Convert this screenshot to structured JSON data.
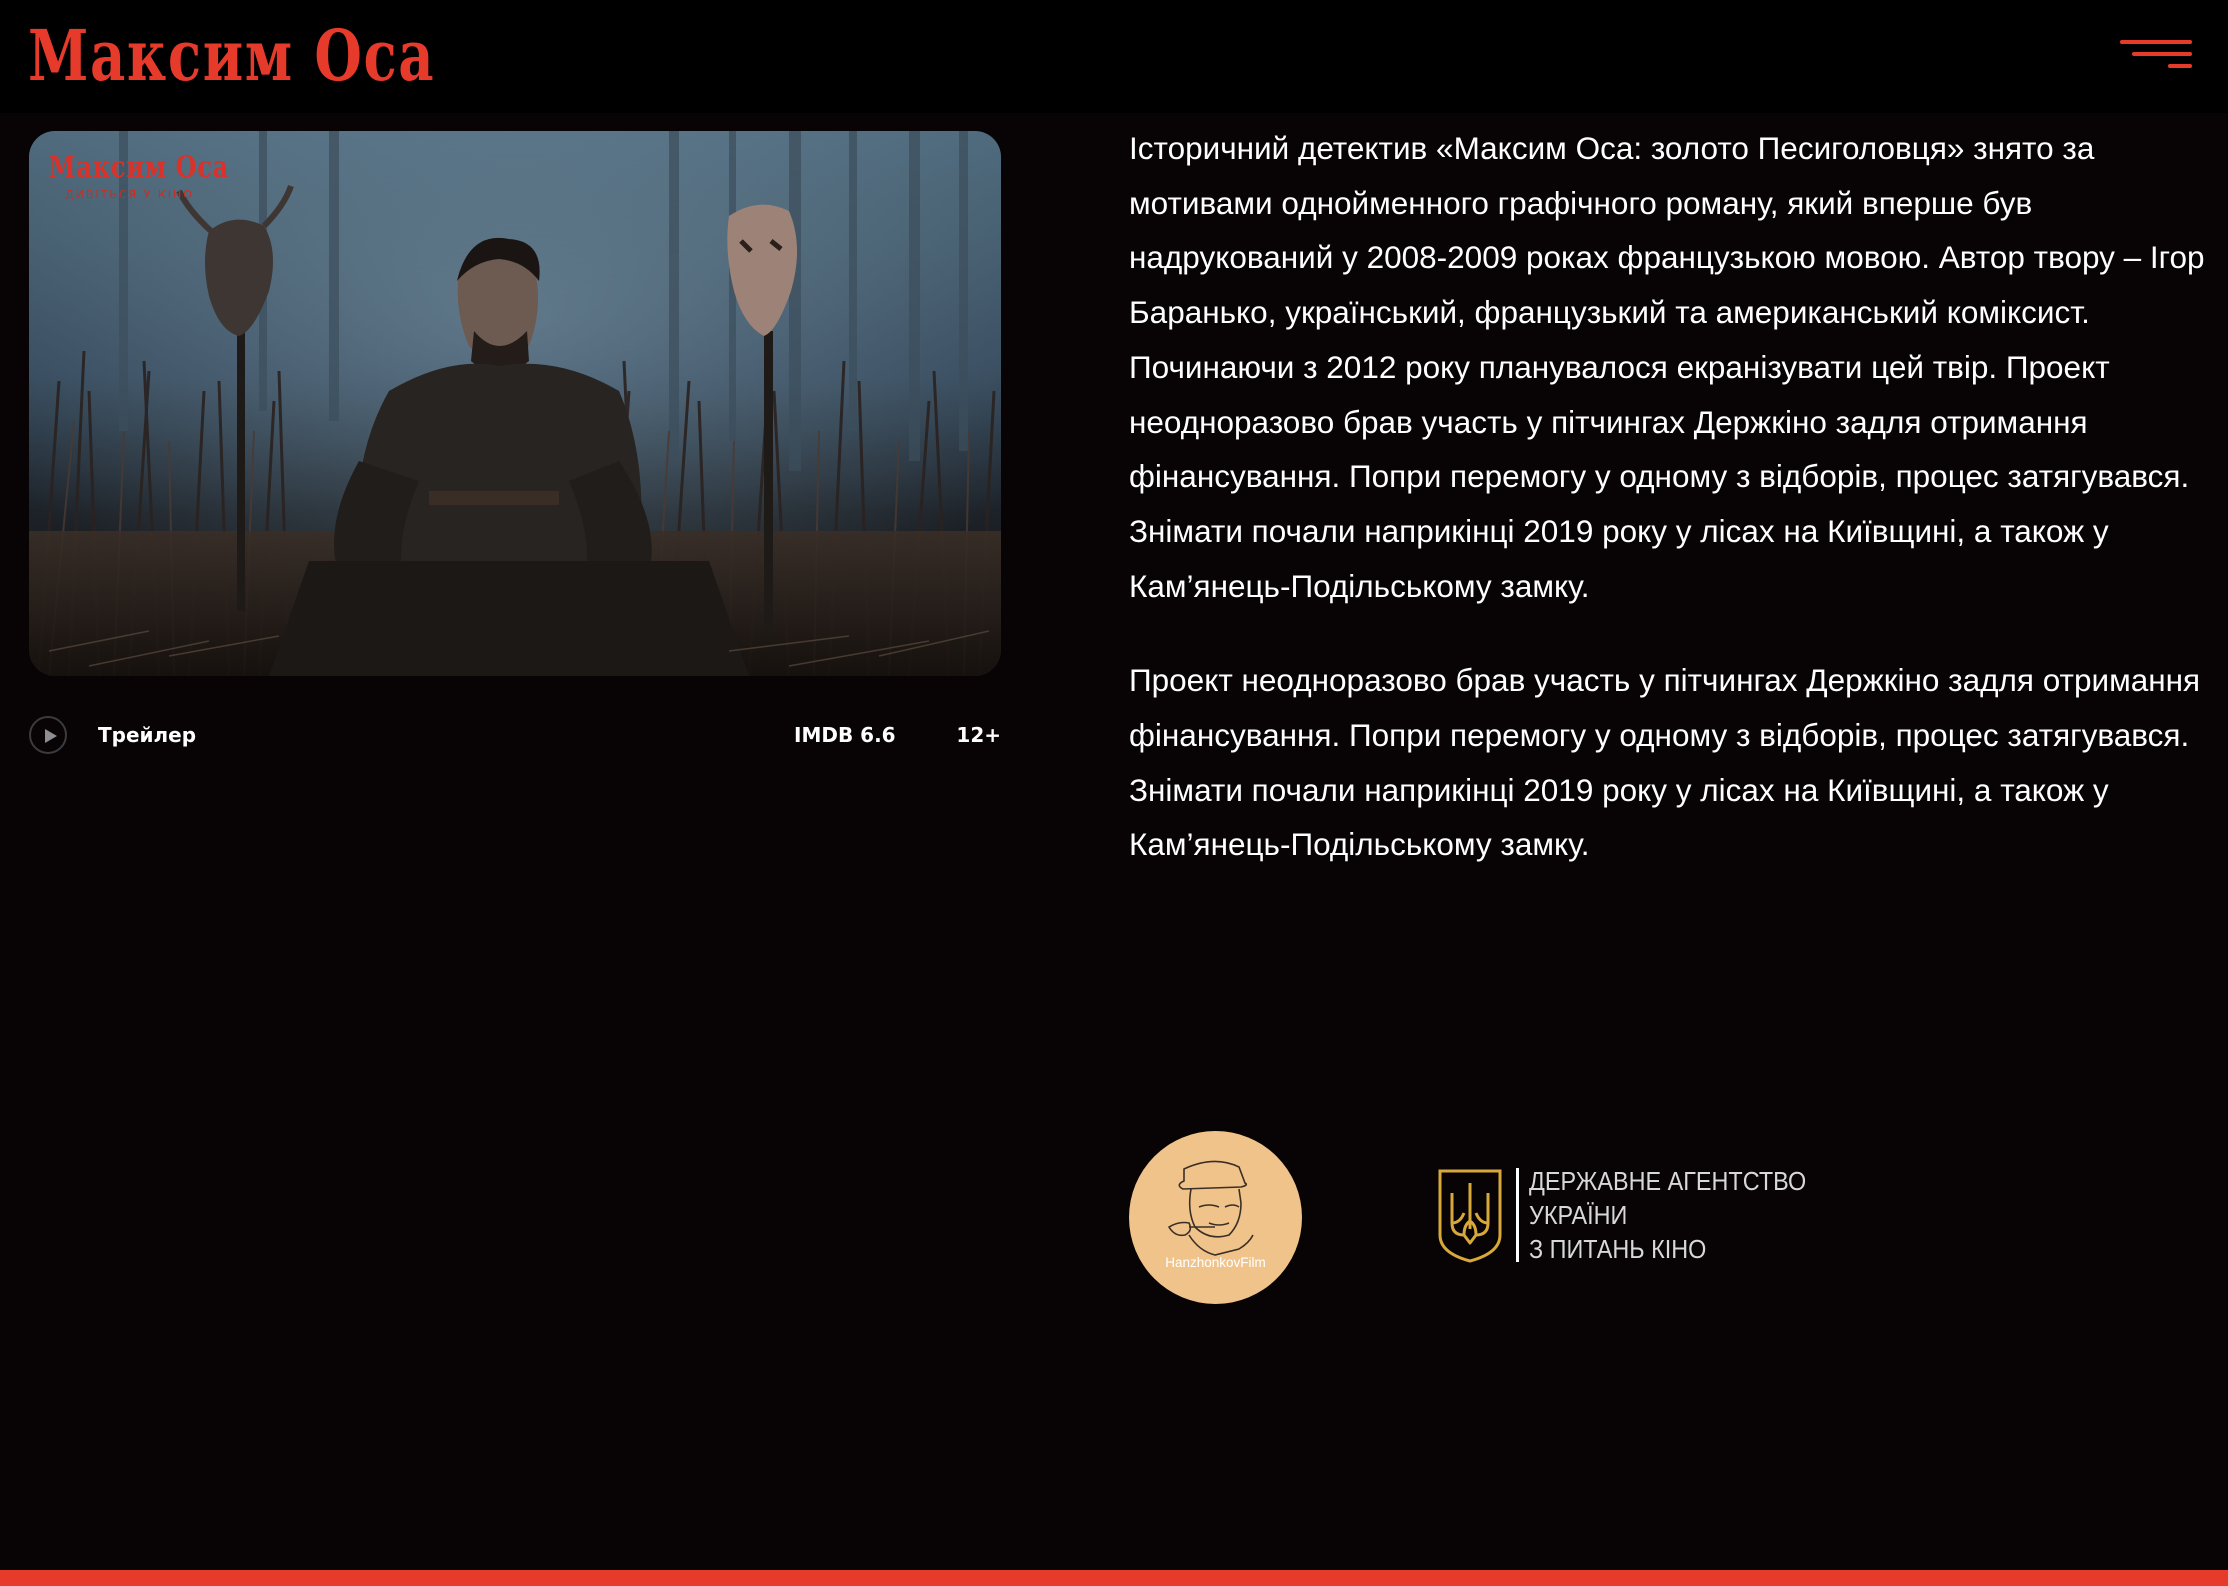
{
  "header": {
    "logo_text": "Максим Оса",
    "menu_icon": "hamburger-menu-icon"
  },
  "poster": {
    "logo_title": "Максим Оса",
    "logo_subtitle": "ДИВІТЬСЯ У КІНО"
  },
  "meta": {
    "play_icon": "play-icon",
    "trailer_label": "Трейлер",
    "imdb": "IMDB 6.6",
    "age_rating": "12+"
  },
  "description": {
    "paragraphs": [
      "Історичний детектив «Максим Оса: золото Песиголовця» знято за мотивами однойменного графічного роману, який вперше був надрукований у 2008-2009 роках французькою мовою. Автор твору – Ігор Баранько, український, французький та американський коміксист. Починаючи з 2012 року планувалося екранізувати цей твір. Проект неодноразово брав участь у пітчингах Держкіно задля отримання фінансування. Попри перемогу у одному з відборів, процес затягувався. Знімати почали наприкінці 2019 року у лісах на Київщині, а також у Кам’янець-Подільському замку.",
      "Проект неодноразово брав участь у пітчингах Держкіно задля отримання фінансування. Попри перемогу у одному з відборів, процес затягувався. Знімати почали наприкінці 2019 року у лісах на Київщині, а також у Кам’янець-Подільському замку."
    ]
  },
  "partners": {
    "hanzhonkov": "HanzhonkovFilm",
    "agency_lines": [
      "ДЕРЖАВНЕ АГЕНТСТВО",
      "УКРАЇНИ",
      "З ПИТАНЬ КІНО"
    ]
  },
  "colors": {
    "accent": "#e63a2b",
    "background": "#080405",
    "header": "#000000",
    "hanzhonkov_logo": "#f0c38a",
    "emblem_gold": "#d8a93a"
  }
}
